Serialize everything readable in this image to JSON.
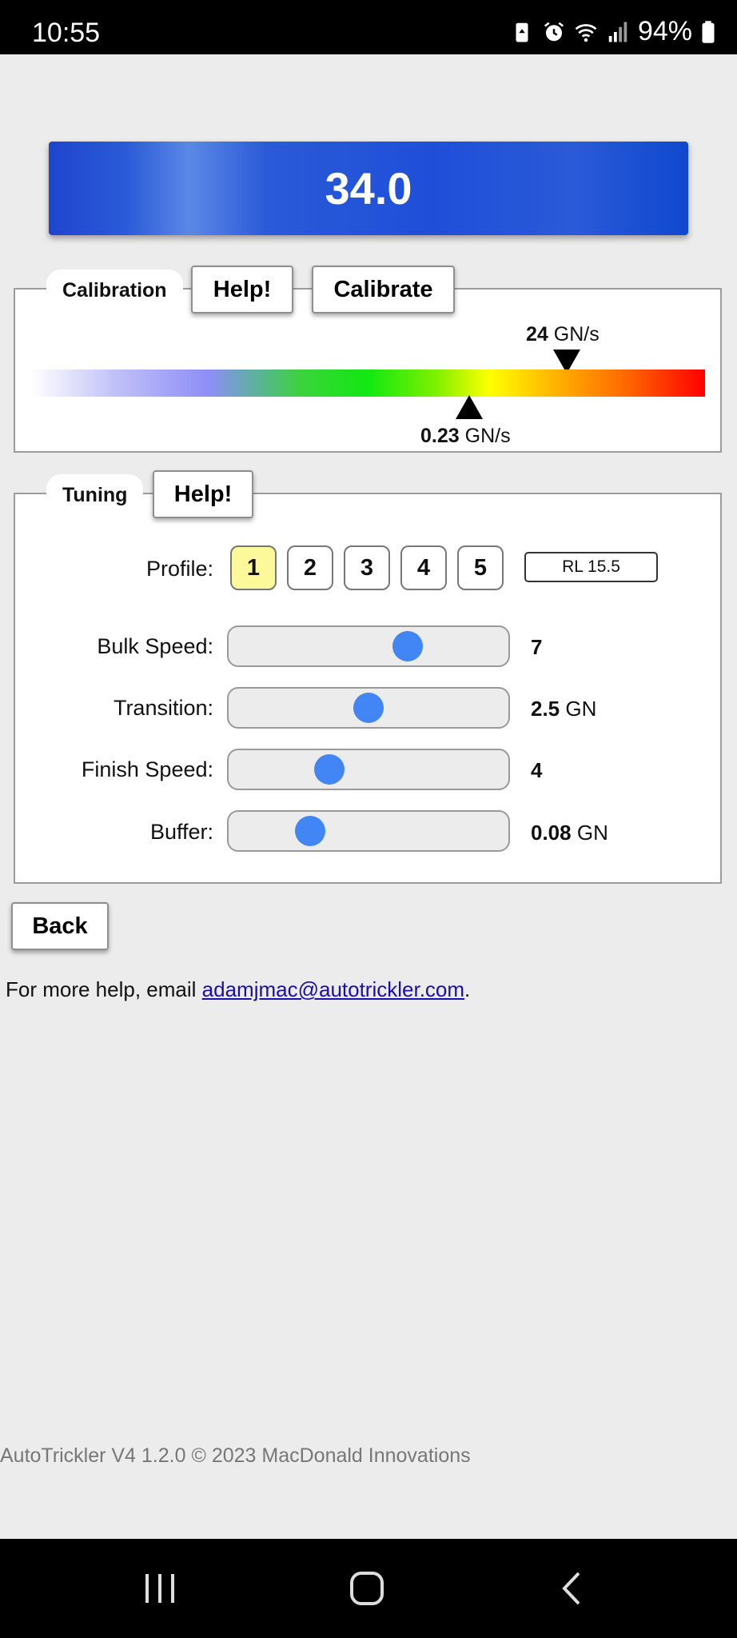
{
  "status_bar": {
    "time": "10:55",
    "battery_percent": "94%",
    "icons": [
      "battery-saver-icon",
      "alarm-icon",
      "wifi-icon",
      "signal-icon",
      "battery-icon"
    ]
  },
  "weight": "34.0",
  "calibration": {
    "legend": "Calibration",
    "help_label": "Help!",
    "calibrate_label": "Calibrate",
    "upper_rate": {
      "value": "24",
      "unit": "GN/s"
    },
    "lower_rate": {
      "value": "0.23",
      "unit": "GN/s"
    },
    "upper_marker_fraction": 0.795,
    "lower_marker_fraction": 0.65
  },
  "tuning": {
    "legend": "Tuning",
    "help_label": "Help!",
    "profile_label": "Profile:",
    "profiles": [
      "1",
      "2",
      "3",
      "4",
      "5"
    ],
    "active_profile": "1",
    "profile_name": "RL 15.5",
    "sliders": [
      {
        "label": "Bulk Speed:",
        "value": "7",
        "unit": "",
        "fraction": 0.64
      },
      {
        "label": "Transition:",
        "value": "2.5",
        "unit": "GN",
        "fraction": 0.5
      },
      {
        "label": "Finish Speed:",
        "value": "4",
        "unit": "",
        "fraction": 0.36
      },
      {
        "label": "Buffer:",
        "value": "0.08",
        "unit": "GN",
        "fraction": 0.29
      }
    ]
  },
  "back_label": "Back",
  "help_prefix": "For more help, email ",
  "help_email": "adamjmac@autotrickler.com",
  "help_suffix": ".",
  "footer": "AutoTrickler V4 1.2.0 © 2023 MacDonald Innovations",
  "colors": {
    "display_blue": "#1f4fd9",
    "active_profile": "#fbf99a",
    "slider_thumb": "#4285f4",
    "link": "#1a0dab"
  }
}
